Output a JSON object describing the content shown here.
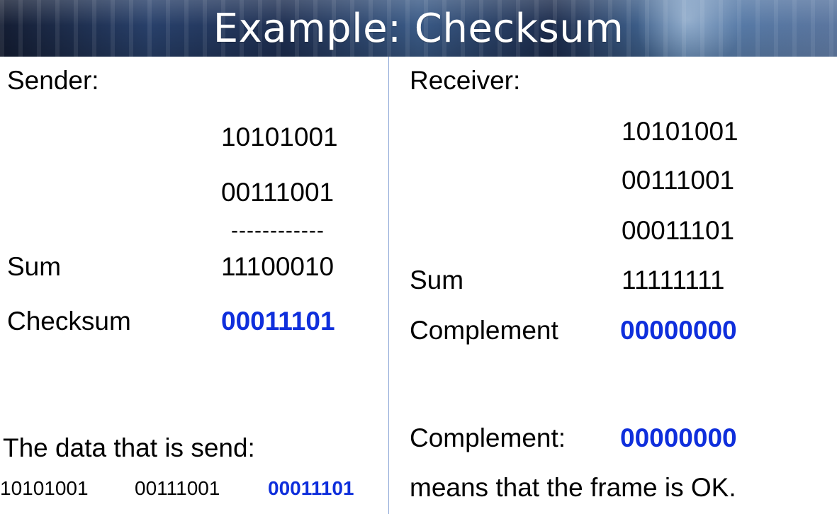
{
  "header": {
    "title": "Example: Checksum"
  },
  "sender": {
    "label": "Sender:",
    "data1": "10101001",
    "data2": "00111001",
    "separator": "------------",
    "sum_label": "Sum",
    "sum_value": "11100010",
    "checksum_label": "Checksum",
    "checksum_value": "00011101"
  },
  "sent_data": {
    "label": "The data that is send:",
    "value1": "10101001",
    "value2": "00111001",
    "value3": "00011101"
  },
  "receiver": {
    "label": "Receiver:",
    "data1": "10101001",
    "data2": "00111001",
    "data3": "00011101",
    "sum_label": "Sum",
    "sum_value": "11111111",
    "complement_label": "Complement",
    "complement_value": "00000000",
    "result_label": "Complement:",
    "result_value": "00000000",
    "message": "means that the frame is OK."
  },
  "colors": {
    "accent": "#0f2fdc",
    "divider": "#8ea8d8"
  }
}
